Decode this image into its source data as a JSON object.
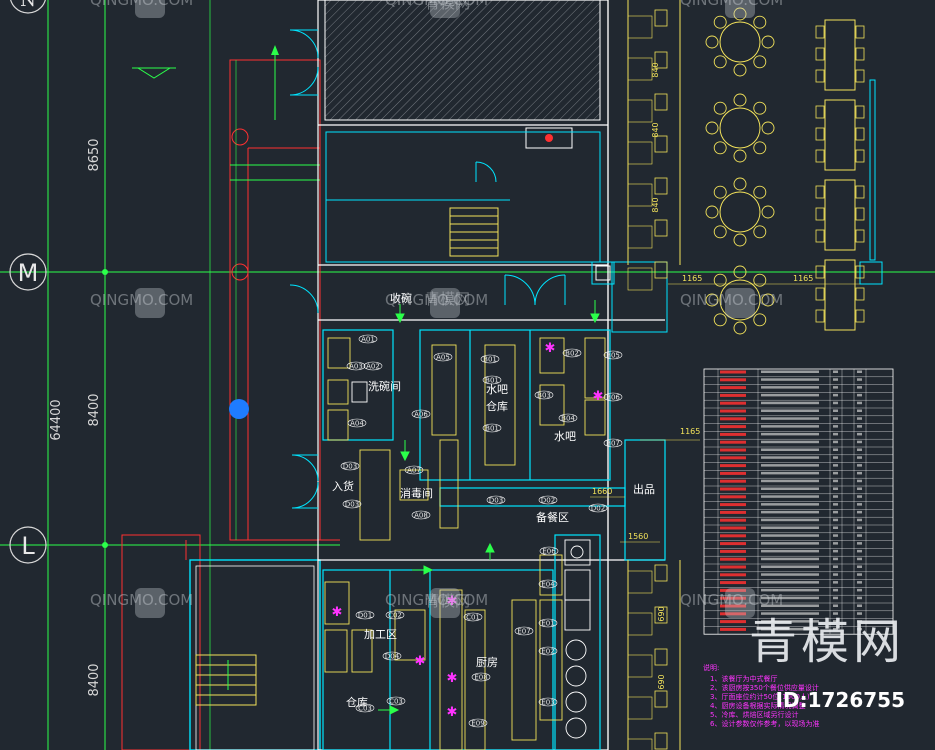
{
  "axes": {
    "M": "M",
    "L": "L",
    "N": "N",
    "dim_8650": "8650",
    "dim_8400a": "8400",
    "dim_64400": "64400",
    "dim_8400b": "8400"
  },
  "rooms": {
    "shouwan": "收碗",
    "xiwanjian": "洗碗间",
    "shuiba_cangku_1": "水吧",
    "shuiba_cangku_2": "仓库",
    "shuiba": "水吧",
    "xiaodujian": "消毒间",
    "ruhuo": "入货",
    "chupin": "出品",
    "beicanqu": "备餐区",
    "jiagongqu": "加工区",
    "chufang": "厨房",
    "cangku": "仓库"
  },
  "dims": {
    "d840a": "840",
    "d840b": "840",
    "d840c": "840",
    "d1165a": "1165",
    "d1165b": "1165",
    "d1165c": "1165",
    "d1660": "1660",
    "d1560": "1560",
    "d690a": "690",
    "d690b": "690"
  },
  "equipment_tags": [
    "A01",
    "A02",
    "A03",
    "A04",
    "A05",
    "A06",
    "A07",
    "A08",
    "B01",
    "B01",
    "B01",
    "B02",
    "B03",
    "B04",
    "B05",
    "B06",
    "B07",
    "D01",
    "D02",
    "D03",
    "D03",
    "D04",
    "E01",
    "E02",
    "E03",
    "E04",
    "E06",
    "E07",
    "E08",
    "E09",
    "C01",
    "C02",
    "C03",
    "C03",
    "D03",
    "D02"
  ],
  "notes": {
    "title": "说明:",
    "lines": [
      "1、该餐厅为中式餐厅",
      "2、该厨房按350个餐位供应量设计",
      "3、厅面座位约计50位(1000人)",
      "4、厨房设备根据实际情况调整",
      "5、冷库、烘焙区域另行设计",
      "6、设计参数仅作参考，以现场为准"
    ]
  },
  "watermarks": {
    "text": "QINGMO.COM",
    "cn": "青模网"
  },
  "brand": {
    "logo_text": "青模网",
    "id_text": "ID:1726755"
  },
  "colors": {
    "background": "#212830",
    "wall_white": "#ffffff",
    "cyan": "#00e5ff",
    "green": "#2bff4a",
    "yellow": "#f2e25a",
    "red": "#ff3030",
    "magenta": "#ff33ff",
    "blue_dot": "#1f7cff",
    "dark_green": "#1fb85a"
  }
}
